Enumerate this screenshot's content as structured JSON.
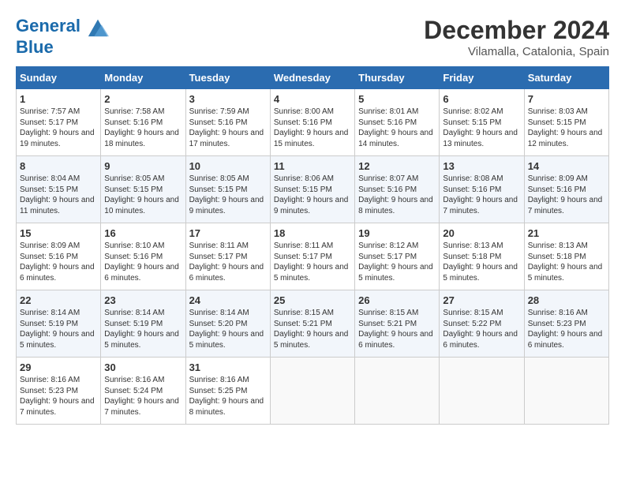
{
  "logo": {
    "line1": "General",
    "line2": "Blue"
  },
  "title": "December 2024",
  "location": "Vilamalla, Catalonia, Spain",
  "days_of_week": [
    "Sunday",
    "Monday",
    "Tuesday",
    "Wednesday",
    "Thursday",
    "Friday",
    "Saturday"
  ],
  "weeks": [
    [
      {
        "day": "1",
        "sunrise": "7:57 AM",
        "sunset": "5:17 PM",
        "daylight": "9 hours and 19 minutes."
      },
      {
        "day": "2",
        "sunrise": "7:58 AM",
        "sunset": "5:16 PM",
        "daylight": "9 hours and 18 minutes."
      },
      {
        "day": "3",
        "sunrise": "7:59 AM",
        "sunset": "5:16 PM",
        "daylight": "9 hours and 17 minutes."
      },
      {
        "day": "4",
        "sunrise": "8:00 AM",
        "sunset": "5:16 PM",
        "daylight": "9 hours and 15 minutes."
      },
      {
        "day": "5",
        "sunrise": "8:01 AM",
        "sunset": "5:16 PM",
        "daylight": "9 hours and 14 minutes."
      },
      {
        "day": "6",
        "sunrise": "8:02 AM",
        "sunset": "5:15 PM",
        "daylight": "9 hours and 13 minutes."
      },
      {
        "day": "7",
        "sunrise": "8:03 AM",
        "sunset": "5:15 PM",
        "daylight": "9 hours and 12 minutes."
      }
    ],
    [
      {
        "day": "8",
        "sunrise": "8:04 AM",
        "sunset": "5:15 PM",
        "daylight": "9 hours and 11 minutes."
      },
      {
        "day": "9",
        "sunrise": "8:05 AM",
        "sunset": "5:15 PM",
        "daylight": "9 hours and 10 minutes."
      },
      {
        "day": "10",
        "sunrise": "8:05 AM",
        "sunset": "5:15 PM",
        "daylight": "9 hours and 9 minutes."
      },
      {
        "day": "11",
        "sunrise": "8:06 AM",
        "sunset": "5:15 PM",
        "daylight": "9 hours and 9 minutes."
      },
      {
        "day": "12",
        "sunrise": "8:07 AM",
        "sunset": "5:16 PM",
        "daylight": "9 hours and 8 minutes."
      },
      {
        "day": "13",
        "sunrise": "8:08 AM",
        "sunset": "5:16 PM",
        "daylight": "9 hours and 7 minutes."
      },
      {
        "day": "14",
        "sunrise": "8:09 AM",
        "sunset": "5:16 PM",
        "daylight": "9 hours and 7 minutes."
      }
    ],
    [
      {
        "day": "15",
        "sunrise": "8:09 AM",
        "sunset": "5:16 PM",
        "daylight": "9 hours and 6 minutes."
      },
      {
        "day": "16",
        "sunrise": "8:10 AM",
        "sunset": "5:16 PM",
        "daylight": "9 hours and 6 minutes."
      },
      {
        "day": "17",
        "sunrise": "8:11 AM",
        "sunset": "5:17 PM",
        "daylight": "9 hours and 6 minutes."
      },
      {
        "day": "18",
        "sunrise": "8:11 AM",
        "sunset": "5:17 PM",
        "daylight": "9 hours and 5 minutes."
      },
      {
        "day": "19",
        "sunrise": "8:12 AM",
        "sunset": "5:17 PM",
        "daylight": "9 hours and 5 minutes."
      },
      {
        "day": "20",
        "sunrise": "8:13 AM",
        "sunset": "5:18 PM",
        "daylight": "9 hours and 5 minutes."
      },
      {
        "day": "21",
        "sunrise": "8:13 AM",
        "sunset": "5:18 PM",
        "daylight": "9 hours and 5 minutes."
      }
    ],
    [
      {
        "day": "22",
        "sunrise": "8:14 AM",
        "sunset": "5:19 PM",
        "daylight": "9 hours and 5 minutes."
      },
      {
        "day": "23",
        "sunrise": "8:14 AM",
        "sunset": "5:19 PM",
        "daylight": "9 hours and 5 minutes."
      },
      {
        "day": "24",
        "sunrise": "8:14 AM",
        "sunset": "5:20 PM",
        "daylight": "9 hours and 5 minutes."
      },
      {
        "day": "25",
        "sunrise": "8:15 AM",
        "sunset": "5:21 PM",
        "daylight": "9 hours and 5 minutes."
      },
      {
        "day": "26",
        "sunrise": "8:15 AM",
        "sunset": "5:21 PM",
        "daylight": "9 hours and 6 minutes."
      },
      {
        "day": "27",
        "sunrise": "8:15 AM",
        "sunset": "5:22 PM",
        "daylight": "9 hours and 6 minutes."
      },
      {
        "day": "28",
        "sunrise": "8:16 AM",
        "sunset": "5:23 PM",
        "daylight": "9 hours and 6 minutes."
      }
    ],
    [
      {
        "day": "29",
        "sunrise": "8:16 AM",
        "sunset": "5:23 PM",
        "daylight": "9 hours and 7 minutes."
      },
      {
        "day": "30",
        "sunrise": "8:16 AM",
        "sunset": "5:24 PM",
        "daylight": "9 hours and 7 minutes."
      },
      {
        "day": "31",
        "sunrise": "8:16 AM",
        "sunset": "5:25 PM",
        "daylight": "9 hours and 8 minutes."
      },
      null,
      null,
      null,
      null
    ]
  ]
}
